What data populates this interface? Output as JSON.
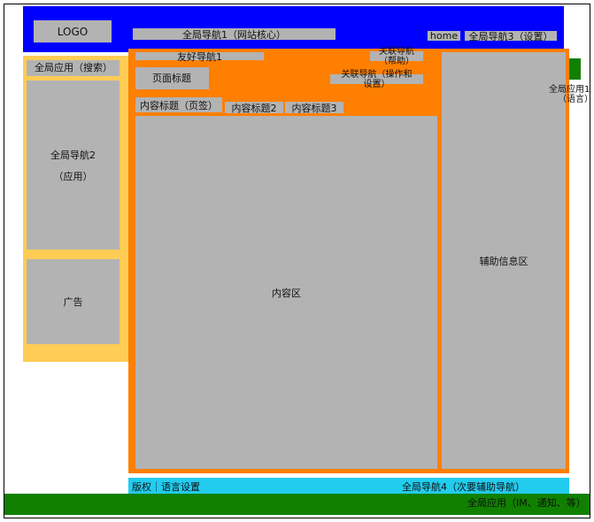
{
  "header": {
    "logo": "LOGO",
    "global_nav_1": "全局导航1（网站核心）",
    "home": "home",
    "global_nav_3": "全局导航3（设置）"
  },
  "left_sidebar": {
    "search": "全局应用（搜索）",
    "global_nav_2_line1": "全局导航2",
    "global_nav_2_line2": "（应用）",
    "ad": "广告"
  },
  "main": {
    "friend_nav": "友好导航1",
    "related_help_line1": "关联导航",
    "related_help_line2": "（帮助）",
    "page_title": "页面标题",
    "related_ops_line1": "关联导航（操作和",
    "related_ops_line2": "设置）",
    "tabs": [
      "内容标题（页签）",
      "内容标题2",
      "内容标题3"
    ],
    "content": "内容区",
    "aux_info": "辅助信息区"
  },
  "right_edge": {
    "lang_line1": "全局应用1",
    "lang_line2": "（语言）"
  },
  "footer": {
    "copyright": "版权｜语言设置",
    "global_nav_4": "全局导航4（次要辅助导航）",
    "global_app_im": "全局应用（IM、通知、等）"
  },
  "colors": {
    "header_blue": "#0000ff",
    "main_orange": "#ff7f00",
    "sidebar_yellow": "#ffcc55",
    "footer_cyan": "#22ccee",
    "footer_green": "#118000",
    "placeholder_gray": "#b3b3b3"
  }
}
